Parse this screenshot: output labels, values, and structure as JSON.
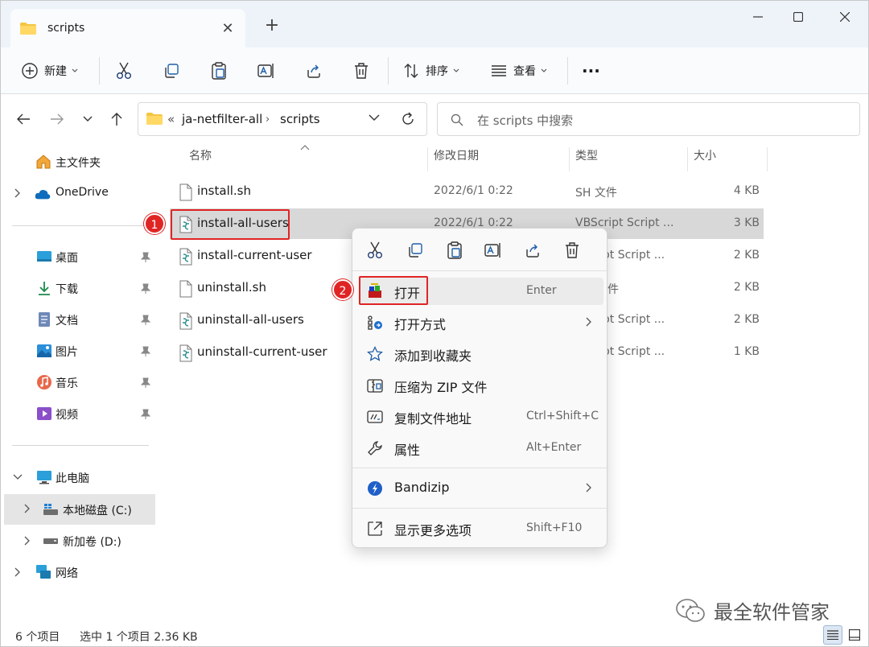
{
  "window": {
    "tab_title": "scripts",
    "new_tab": "+"
  },
  "toolbar": {
    "new_label": "新建",
    "sort_label": "排序",
    "view_label": "查看",
    "more_label": "···"
  },
  "address": {
    "overflow": "«",
    "path": [
      "ja-netfilter-all",
      "scripts"
    ],
    "search_placeholder": "在 scripts 中搜索"
  },
  "sidebar": {
    "home": "主文件夹",
    "onedrive": "OneDrive",
    "quick": [
      {
        "label": "桌面",
        "icon": "desktop-icon"
      },
      {
        "label": "下载",
        "icon": "download-icon"
      },
      {
        "label": "文档",
        "icon": "documents-icon"
      },
      {
        "label": "图片",
        "icon": "pictures-icon"
      },
      {
        "label": "音乐",
        "icon": "music-icon"
      },
      {
        "label": "视频",
        "icon": "videos-icon"
      }
    ],
    "this_pc": "此电脑",
    "drives": [
      {
        "label": "本地磁盘 (C:)"
      },
      {
        "label": "新加卷 (D:)"
      }
    ],
    "network": "网络"
  },
  "columns": {
    "name": "名称",
    "date": "修改日期",
    "type": "类型",
    "size": "大小"
  },
  "files": [
    {
      "name": "install.sh",
      "date": "2022/6/1 0:22",
      "type": "SH 文件",
      "size": "4 KB",
      "icon": "sh-file-icon"
    },
    {
      "name": "install-all-users",
      "date": "2022/6/1 0:22",
      "type": "VBScript Script ...",
      "size": "3 KB",
      "icon": "vbscript-file-icon"
    },
    {
      "name": "install-current-user",
      "date": "",
      "type": "ipt Script ...",
      "size": "2 KB",
      "icon": "vbscript-file-icon"
    },
    {
      "name": "uninstall.sh",
      "date": "",
      "type": "件",
      "size": "2 KB",
      "icon": "sh-file-icon"
    },
    {
      "name": "uninstall-all-users",
      "date": "",
      "type": "ipt Script ...",
      "size": "2 KB",
      "icon": "vbscript-file-icon"
    },
    {
      "name": "uninstall-current-user",
      "date": "",
      "type": "ipt Script ...",
      "size": "1 KB",
      "icon": "vbscript-file-icon"
    }
  ],
  "annotations": {
    "step1": "1",
    "step2": "2"
  },
  "context_menu": {
    "items": [
      {
        "label": "打开",
        "key": "Enter",
        "icon": "open-icon"
      },
      {
        "label": "打开方式",
        "key": "",
        "icon": "open-with-icon"
      },
      {
        "label": "添加到收藏夹",
        "key": "",
        "icon": "star-icon"
      },
      {
        "label": "压缩为 ZIP 文件",
        "key": "",
        "icon": "zip-icon"
      },
      {
        "label": "复制文件地址",
        "key": "Ctrl+Shift+C",
        "icon": "copy-path-icon"
      },
      {
        "label": "属性",
        "key": "Alt+Enter",
        "icon": "properties-icon"
      },
      {
        "label": "Bandizip",
        "key": "",
        "icon": "bandizip-icon"
      },
      {
        "label": "显示更多选项",
        "key": "Shift+F10",
        "icon": "more-options-icon"
      }
    ]
  },
  "status": {
    "count": "6 个项目",
    "selected": "选中 1 个项目  2.36 KB"
  },
  "watermark": "最全软件管家",
  "colors": {
    "accent": "#0067c0",
    "highlight": "#e02424",
    "folder": "#f4c542"
  }
}
